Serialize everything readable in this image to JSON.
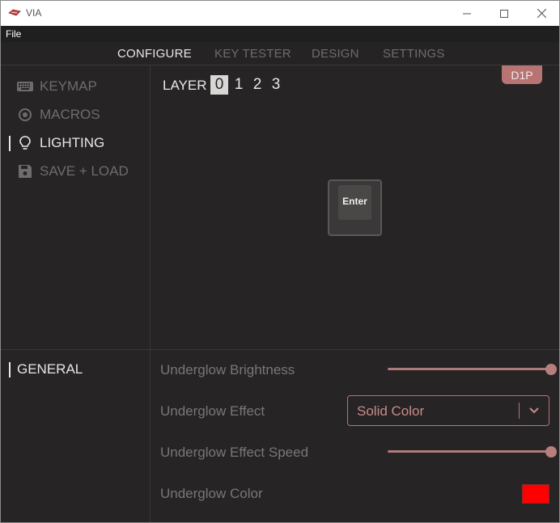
{
  "window": {
    "title": "VIA"
  },
  "menu": {
    "file": "File"
  },
  "tabs": [
    {
      "label": "CONFIGURE",
      "active": true
    },
    {
      "label": "KEY TESTER",
      "active": false
    },
    {
      "label": "DESIGN",
      "active": false
    },
    {
      "label": "SETTINGS",
      "active": false
    }
  ],
  "sidebar": {
    "items": [
      {
        "label": "KEYMAP",
        "icon": "keyboard-icon",
        "active": false
      },
      {
        "label": "MACROS",
        "icon": "record-icon",
        "active": false
      },
      {
        "label": "LIGHTING",
        "icon": "lightbulb-icon",
        "active": true
      },
      {
        "label": "SAVE + LOAD",
        "icon": "floppy-disk-icon",
        "active": false
      }
    ]
  },
  "keyboard": {
    "layer_label": "LAYER",
    "layers": [
      "0",
      "1",
      "2",
      "3"
    ],
    "selected_layer": "0",
    "device_badge": "D1P",
    "keys": [
      {
        "label": "Enter"
      }
    ]
  },
  "lighting": {
    "section": "GENERAL",
    "rows": {
      "brightness": {
        "label": "Underglow Brightness",
        "value": 1.0
      },
      "effect": {
        "label": "Underglow Effect",
        "value": "Solid Color"
      },
      "speed": {
        "label": "Underglow Effect Speed",
        "value": 1.0
      },
      "color": {
        "label": "Underglow Color",
        "value": "#ff0000"
      }
    }
  },
  "colors": {
    "accent": "#b87373",
    "background": "#262424",
    "text_active": "#e8e6e6",
    "text_inactive": "#6f6c6c"
  }
}
